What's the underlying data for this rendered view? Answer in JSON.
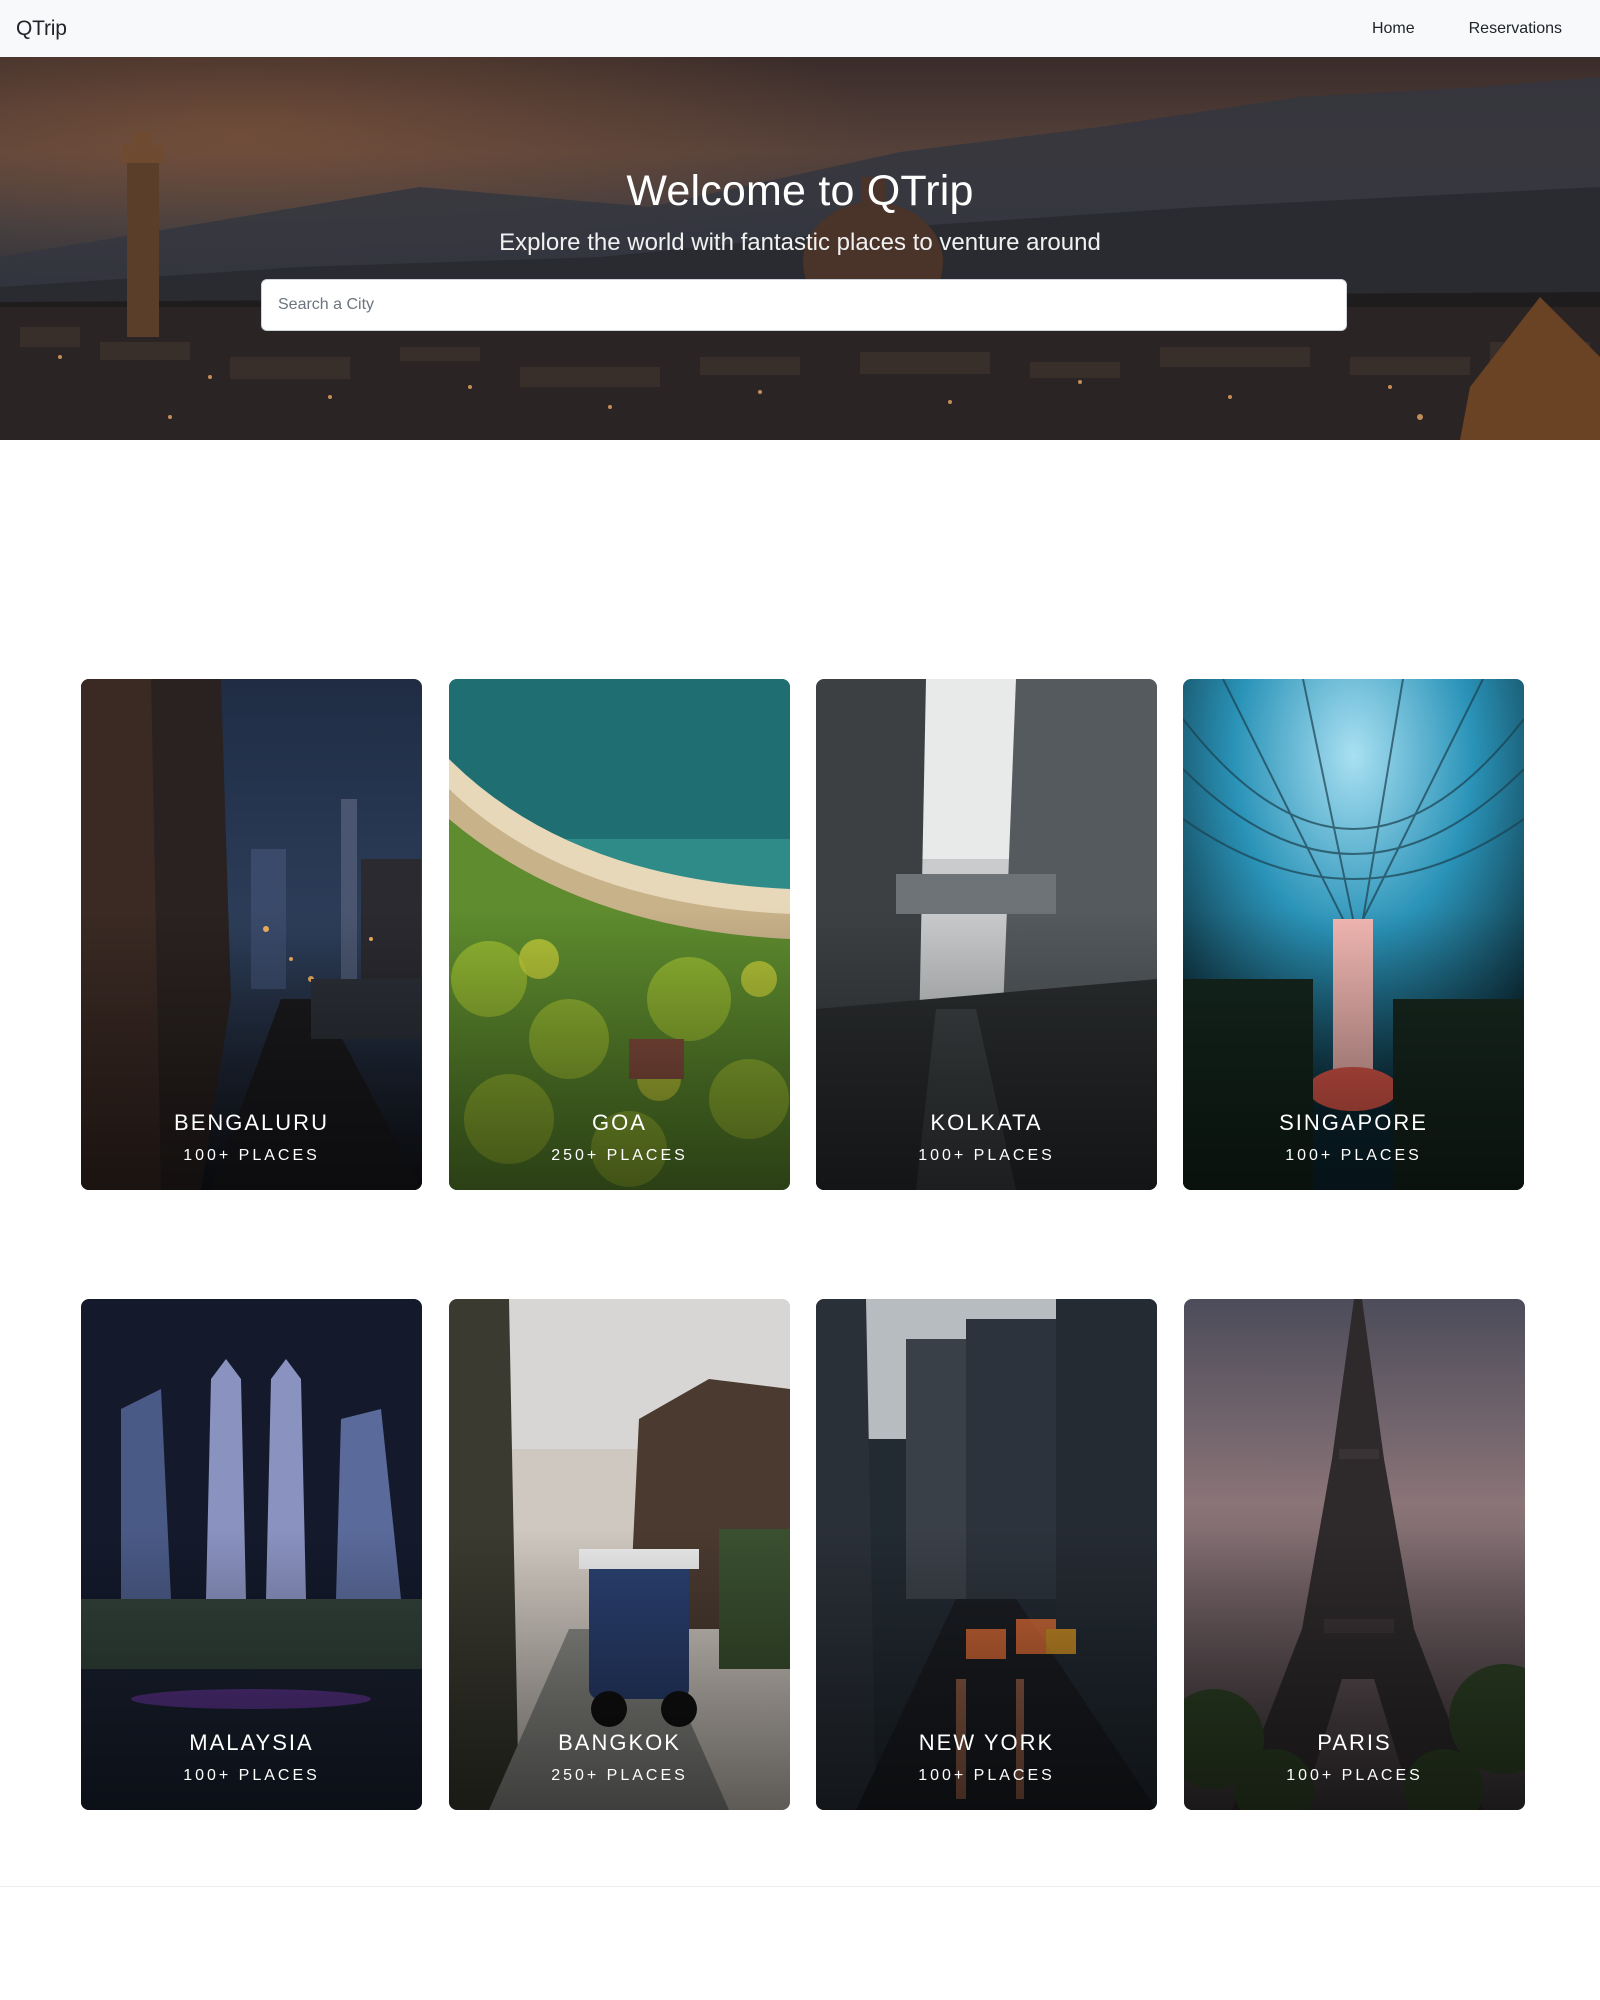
{
  "navbar": {
    "brand": "QTrip",
    "links": [
      {
        "label": "Home"
      },
      {
        "label": "Reservations"
      }
    ]
  },
  "hero": {
    "title": "Welcome to QTrip",
    "subtitle": "Explore the world with fantastic places to venture around",
    "search_placeholder": "Search a City"
  },
  "cities": [
    {
      "name": "BENGALURU",
      "places": "100+ PLACES"
    },
    {
      "name": "GOA",
      "places": "250+ PLACES"
    },
    {
      "name": "KOLKATA",
      "places": "100+ PLACES"
    },
    {
      "name": "SINGAPORE",
      "places": "100+ PLACES"
    },
    {
      "name": "MALAYSIA",
      "places": "100+ PLACES"
    },
    {
      "name": "BANGKOK",
      "places": "250+ PLACES"
    },
    {
      "name": "NEW YORK",
      "places": "100+ PLACES"
    },
    {
      "name": "PARIS",
      "places": "100+ PLACES"
    }
  ],
  "colors": {
    "navbar_bg": "#f8f9fa",
    "text": "#212529",
    "card_text": "#ffffff"
  }
}
